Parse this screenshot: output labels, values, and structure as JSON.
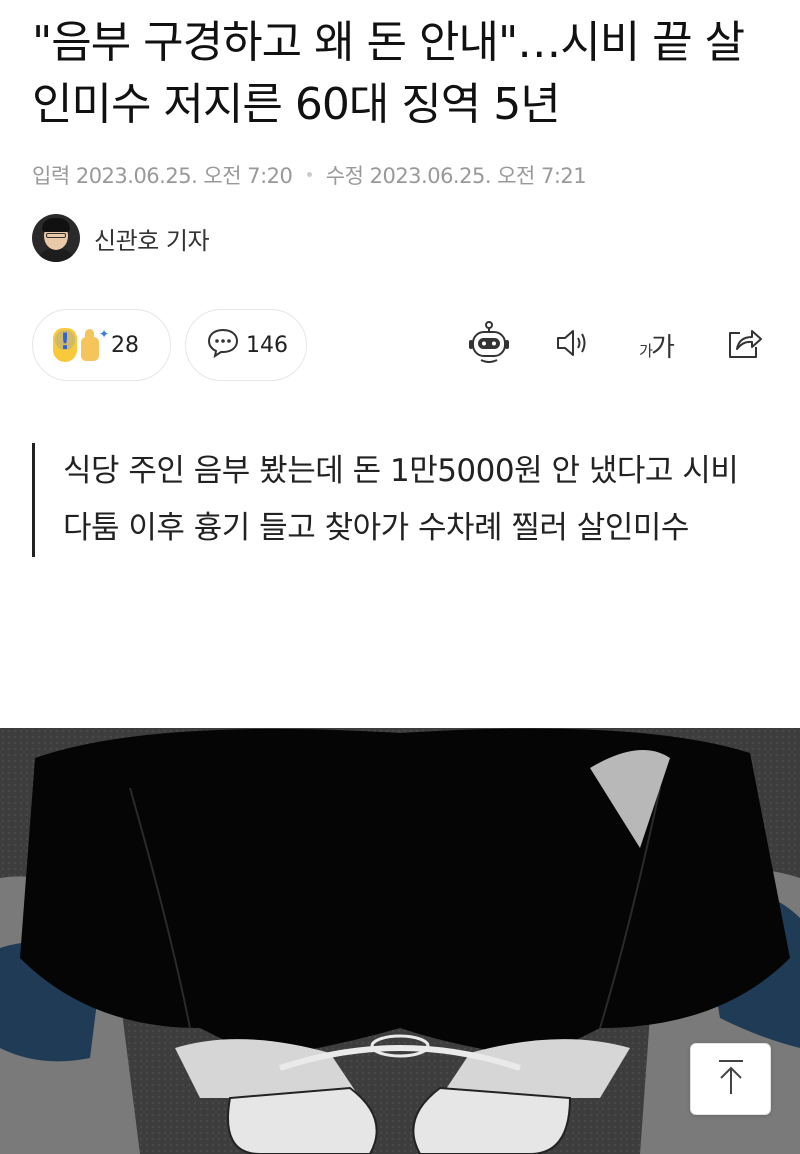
{
  "article": {
    "headline": "\"음부 구경하고 왜 돈 안내\"…시비 끝 살인미수 저지른 60대 징역 5년",
    "input_label": "입력",
    "input_date": "2023.06.25. 오전 7:20",
    "modified_label": "수정",
    "modified_date": "2023.06.25. 오전 7:21",
    "author": "신관호 기자",
    "summary": [
      "식당 주인 음부 봤는데 돈 1만5000원 안 냈다고 시비",
      "다툼 이후 흉기 들고 찾아가 수차례 찔러 살인미수"
    ]
  },
  "actions": {
    "reaction_count": "28",
    "comment_count": "146",
    "font_size_label_small": "가",
    "font_size_label_large": "가"
  },
  "icons": {
    "reaction": "exclamation-thumbs-up-icon",
    "comment": "speech-bubble-icon",
    "summary_bot": "robot-icon",
    "tts": "speaker-icon",
    "share": "share-icon",
    "scroll_top": "arrow-up-icon"
  },
  "colors": {
    "text": "#111111",
    "meta": "#999999",
    "border": "#e6e6e6"
  }
}
